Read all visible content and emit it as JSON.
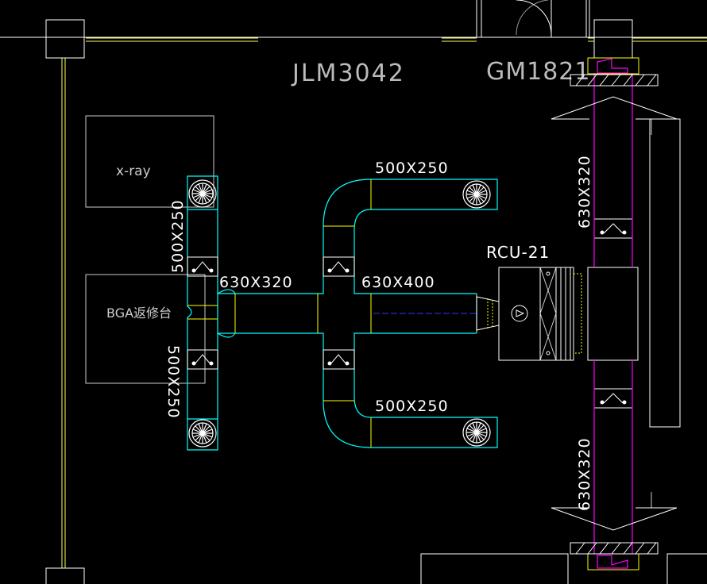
{
  "labels": {
    "jlm": "JLM3042",
    "gm": "GM1821",
    "xray": "x-ray",
    "bga": "BGA返修台",
    "rcu": "RCU-21",
    "left_top_duct": "500X250",
    "left_bottom_duct": "500X250",
    "main_duct_left": "630X320",
    "main_duct_right": "630X400",
    "top_branch_duct": "500X250",
    "bottom_branch_duct": "500X250",
    "right_upper_duct": "630X320",
    "right_lower_duct": "630X320"
  },
  "colors": {
    "background": "#000000",
    "wall": "#ffffff",
    "wall_yellow": "#ffff66",
    "duct": "#00ffff",
    "equipment": "#ffffff",
    "magenta": "#ff00ff",
    "yellow": "#ffff00",
    "blue": "#3333ff",
    "gray": "#b0b0b0"
  }
}
